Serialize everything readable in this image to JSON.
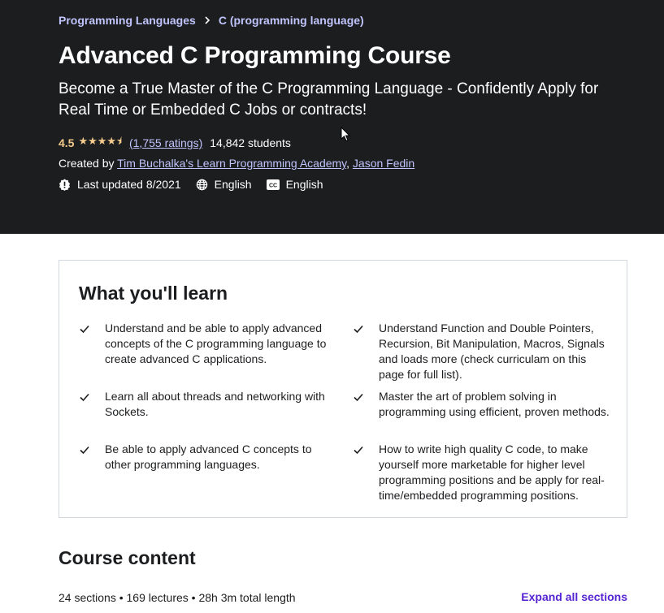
{
  "breadcrumb": [
    "Programming Languages",
    "C (programming language)"
  ],
  "course": {
    "title": "Advanced C Programming Course",
    "subtitle": "Become a True Master of the C Programming Language - Confidently Apply for Real Time or Embedded C Jobs or contracts!",
    "rating": "4.5",
    "stars": "★★★★⯨",
    "rating_count": "(1,755 ratings)",
    "students": "14,842 students",
    "created_by_label": "Created by",
    "authors": [
      "Tim Buchalka's Learn Programming Academy",
      "Jason Fedin"
    ],
    "last_updated": "Last updated 8/2021",
    "language": "English",
    "captions": "English"
  },
  "learn": {
    "title": "What you'll learn",
    "items": [
      "Understand and be able to apply advanced concepts of the C programming language to create advanced C applications.",
      "Understand Function and Double Pointers, Recursion, Bit Manipulation, Macros, Signals and loads more (check curriculam on this page for full list).",
      "Learn all about threads and networking with Sockets.",
      "Master the art of problem solving in programming using efficient, proven methods.",
      "Be able to apply advanced C concepts to other programming languages.",
      "How to write high quality C code, to make yourself more marketable for higher level programming positions and be apply for real-time/embedded programming positions."
    ]
  },
  "content": {
    "title": "Course content",
    "meta": "24 sections • 169 lectures • 28h 3m total length",
    "expand_label": "Expand all sections"
  },
  "colors": {
    "hero_bg": "#1c1d1f",
    "link_purple": "#c0c4fc",
    "star": "#f3ca8c",
    "accent": "#5624d0"
  }
}
